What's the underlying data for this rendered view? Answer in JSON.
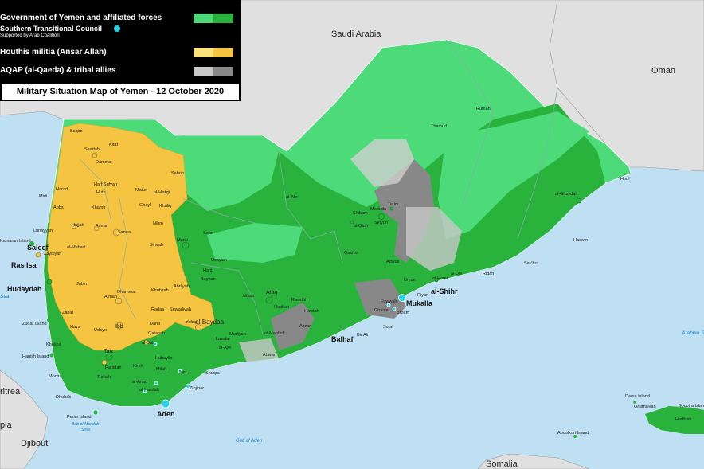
{
  "legend": {
    "gov": {
      "label": "Government of Yemen and affiliated forces",
      "colors": [
        "#4ddb7a",
        "#29b33d"
      ]
    },
    "stc": {
      "label": "Southern Transitional Council",
      "icon": "cyan-dot-icon",
      "color": "#22d3e6"
    },
    "coalition": "Supported by Arab Coalition",
    "houthi": {
      "label": "Houthis militia (Ansar Allah)",
      "colors": [
        "#ffe27a",
        "#f5c542"
      ]
    },
    "aqap": {
      "label": "AQAP (al-Qaeda) & tribal allies",
      "colors": [
        "#c8c8c8",
        "#888888"
      ]
    },
    "title": "Military Situation Map of Yemen  -  12 October 2020"
  },
  "countries": [
    "Saudi Arabia",
    "Oman",
    "Eritrea",
    "Djibouti",
    "Somalia",
    "pia"
  ],
  "seas": [
    "Sea",
    "Arabian S",
    "Bab-el-Mandeb Strait",
    "Gulf of Aden"
  ],
  "major_cities": [
    "Ras Isa",
    "Hudaydah",
    "Saleef",
    "Aden",
    "Mukalla",
    "al-Shihr",
    "Balhaf"
  ],
  "towns": [
    "Baqim",
    "Saadah",
    "Kitaf",
    "Dammaj",
    "Harf Sufyan",
    "Huth",
    "Matun",
    "al-Hazm",
    "Sabrin",
    "Khamir",
    "Ghayl",
    "Khaliq",
    "Hajjah",
    "Amran",
    "Sanaa",
    "Sirwah",
    "Marib",
    "Midi",
    "Harad",
    "Abbs",
    "Luhayyah",
    "Kamaran Island",
    "Zaydiyah",
    "al-Mahwit",
    "Safer",
    "Nihm",
    "Usaylan",
    "Harib",
    "Bayhan",
    "Jabin",
    "Dhammar",
    "Atmah",
    "Radaa",
    "Abdiyah",
    "Khubzah",
    "Suwadiyah",
    "al-Baydaa",
    "Zabid",
    "Hays",
    "Udayn",
    "Ibb",
    "Qatabah",
    "Damt",
    "Yafaa",
    "Mudiyah",
    "Lawdar",
    "al-Ayn",
    "Ataq",
    "Nisab",
    "Habban",
    "Rawdah",
    "Hawtah",
    "Azzan",
    "al-Mahfad",
    "Ahwar",
    "Bir Ali",
    "Sufal",
    "Fuwwah",
    "Ghaida",
    "Broum",
    "Riyan",
    "Uryun",
    "al-Hami",
    "al-Dis",
    "Ridah",
    "Sayhut",
    "Haswin",
    "Adwas",
    "Qaidun",
    "al-Qatn",
    "Shibam",
    "Maduda",
    "Seiyun",
    "Tarim",
    "Thamud",
    "Rumah",
    "al-Ghaydah",
    "Houf",
    "al-Abr",
    "Mocha",
    "Khokha",
    "Dhubab",
    "Zuqar Island",
    "Hanish Island",
    "Perim Island",
    "Taiz",
    "Turbah",
    "Rahidah",
    "Kirsh",
    "Hubaylin",
    "Milah",
    "Jaar",
    "Shuqra",
    "Zinjibar",
    "al-Anad",
    "al-Hawtah",
    "Dali",
    "Rawdah",
    "Qaflah",
    "Ibb",
    "Qa'tabah",
    "al-Dali",
    "Abdulkuri Island",
    "Darsa Island",
    "Qalansiyah",
    "Hadiboh",
    "Socotra Island"
  ]
}
